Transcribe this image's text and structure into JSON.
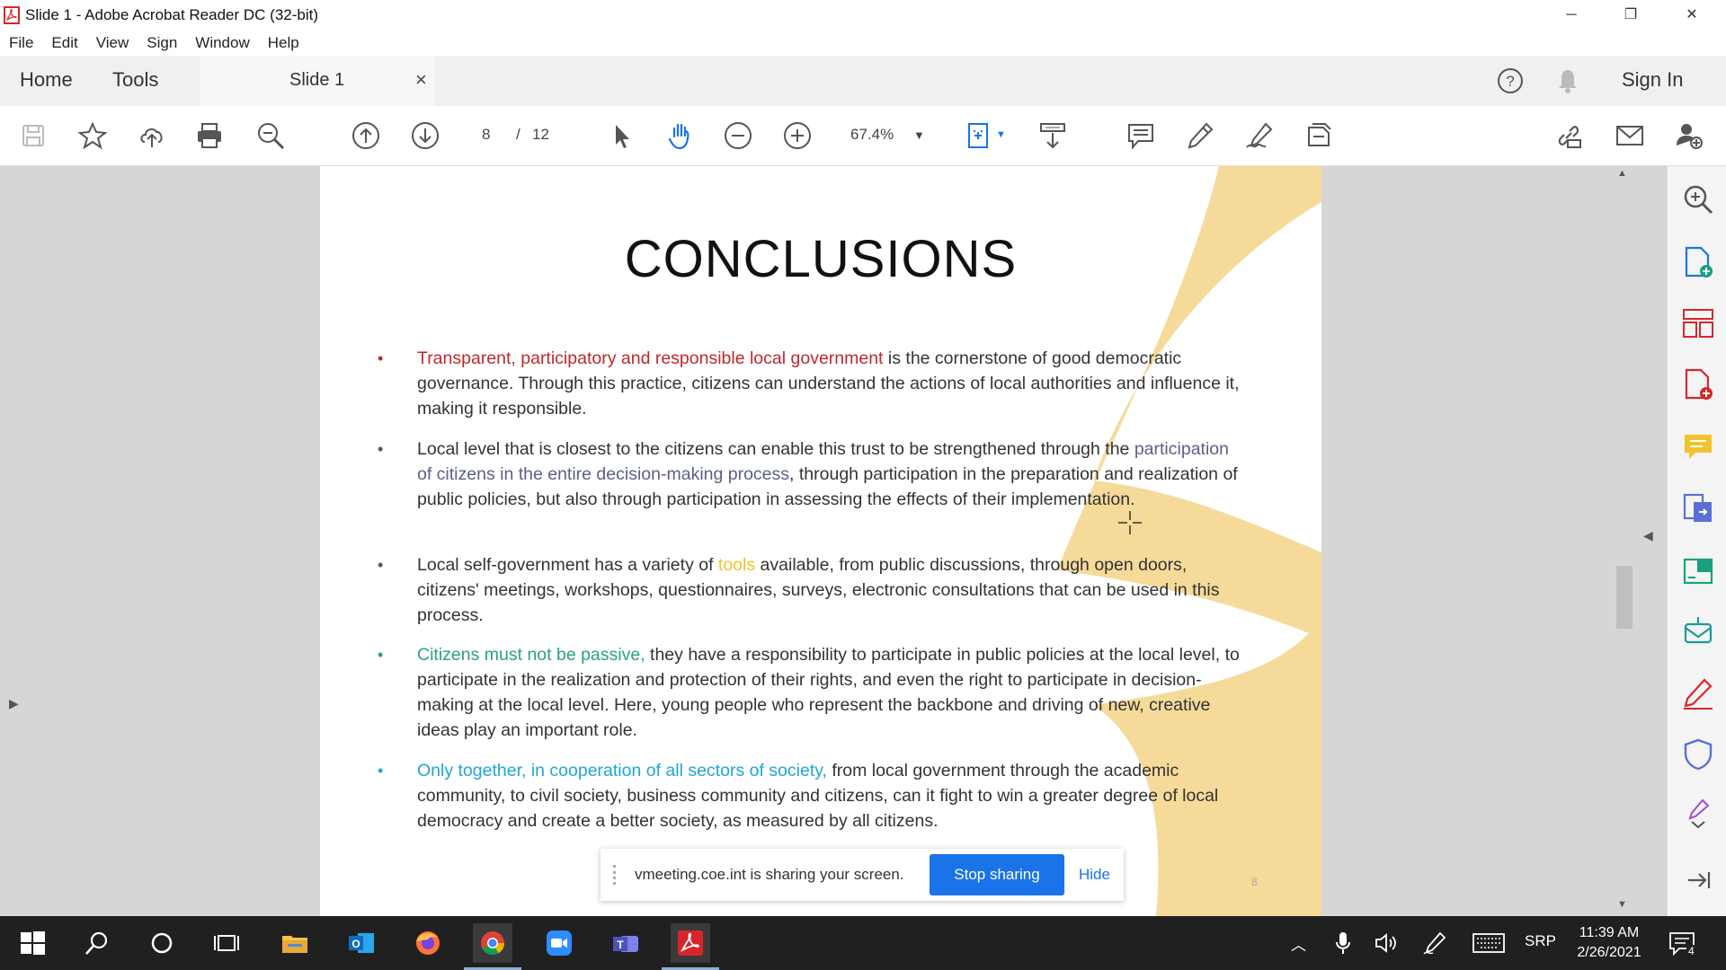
{
  "window": {
    "title": "Slide 1 - Adobe Acrobat Reader DC (32-bit)"
  },
  "menu": [
    "File",
    "Edit",
    "View",
    "Sign",
    "Window",
    "Help"
  ],
  "tabs": {
    "home": "Home",
    "tools": "Tools",
    "document": "Slide 1",
    "close": "×",
    "sign_in": "Sign In"
  },
  "toolbar": {
    "page_current": "8",
    "page_sep": "/",
    "page_total": "12",
    "zoom": "67.4%"
  },
  "slide": {
    "title": "CONCLUSIONS",
    "bullets": [
      {
        "highlight": "Transparent, participatory and responsible local government",
        "highlight_color": "#c0272d",
        "text": " is the cornerstone of good democratic governance. Through this practice, citizens can understand the actions of local authorities and influence it, making it responsible."
      },
      {
        "pre": "Local level that is closest to the citizens can enable this trust to be strengthened through the ",
        "highlight": "participation of citizens in the entire decision-making process",
        "highlight_color": "#5b5f8a",
        "text": ", through participation in the preparation and realization of public policies, but also through participation in assessing the effects of their implementation."
      },
      {
        "pre": "Local self-government has a variety of ",
        "highlight": "tools",
        "highlight_color": "#f2c12e",
        "text": " available, from public discussions, through open doors, citizens' meetings, workshops, questionnaires, surveys, electronic consultations that can be used in this process."
      },
      {
        "highlight": "Citizens must not be passive,",
        "highlight_color": "#2aa37a",
        "text": " they have a responsibility to participate in public policies at the local level, to participate in the realization and protection of their rights, and even the right to participate in decision-making at the local level. Here, young people who represent the backbone and driving of new, creative ideas play an important role."
      },
      {
        "highlight": "Only together, in cooperation of all sectors of society,",
        "highlight_color": "#1fa5d8",
        "text": " from local government through the academic community, to civil society, business community and citizens, can it fight to win a greater degree of local democracy and create a better society, as measured by all citizens."
      }
    ],
    "page_footer": "8"
  },
  "share_banner": {
    "message": "vmeeting.coe.int is sharing your screen.",
    "stop": "Stop sharing",
    "hide": "Hide"
  },
  "taskbar": {
    "language": "SRP",
    "time": "11:39 AM",
    "date": "2/26/2021",
    "notifications": "4"
  },
  "colors": {
    "acrobat_red": "#d7262b",
    "accent_blue": "#1a73e8",
    "deco_yellow": "#f3d488"
  }
}
